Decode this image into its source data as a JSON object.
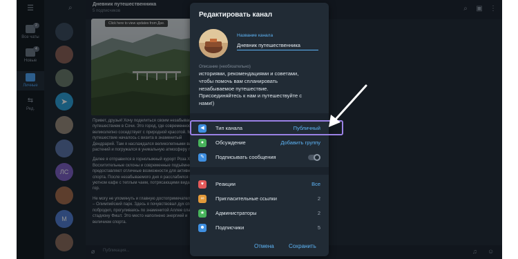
{
  "rail": {
    "items": [
      {
        "label": "Все чаты",
        "badge": "2"
      },
      {
        "label": "Новые",
        "badge": "4"
      },
      {
        "label": "Личные",
        "badge": ""
      },
      {
        "label": "Ред.",
        "badge": ""
      }
    ]
  },
  "chatlist": {
    "avatar_initials": "ЛС",
    "avatar_initials_2": "М"
  },
  "chat": {
    "title": "Дневник путешественника",
    "subtitle": "5 подписчиков",
    "banner": "Click here to view updates from Дне.",
    "post_paragraphs": [
      "Привет, друзья! Хочу поделиться своим незабываемым путешествием в Сочи. Это город, где современность великолепно соседствует с природной красотой. Моё путешествие началось с визита в знаменитый Дендрарий. Там я наслаждался великолепными видами растений и погружался в уникальную атмосферу парка.",
      "Далее я отправился в горнолыжный курорт Роза Хутор. Восхитительные склоны и современные подъёмники предоставляют отличные возможности для активного спорта. После незабываемого дня я расслабился в уютном кафе с теплым чаем, потрясающими видами гор.",
      "Не могу не упомянуть и главную достопримечательность – Олимпийский парк. Здесь я почувствовал дух спорта, побродил, прогуливаясь по знаменитой Аллее славы и стадиону Фишт. Это место наполнено энергией и величием спорта."
    ],
    "composer_placeholder": "Публикация..."
  },
  "dialog": {
    "title": "Редактировать канал",
    "name_label": "Название канала",
    "name_value": "Дневник путешественника",
    "desc_label": "Описание (необязательно)",
    "desc_lines": [
      "историями, рекомендациями и советами,",
      "чтобы помочь вам спланировать",
      "незабываемое путешествие.",
      "Присоединяйтесь к нам и путешествуйте с",
      "нами!)"
    ],
    "rows_group1": [
      {
        "label": "Тип канала",
        "value": "Публичный"
      },
      {
        "label": "Обсуждение",
        "value": "Добавить группу"
      },
      {
        "label": "Подписывать сообщения",
        "value": ""
      }
    ],
    "rows_group2": [
      {
        "label": "Реакции",
        "value": "Все"
      },
      {
        "label": "Пригласительные ссылки",
        "value": "2"
      },
      {
        "label": "Администраторы",
        "value": "2"
      },
      {
        "label": "Подписчики",
        "value": "5"
      }
    ],
    "sign_messages_enabled": false,
    "cancel_label": "Отмена",
    "save_label": "Сохранить"
  },
  "colors": {
    "accent": "#5eb5f7",
    "highlight": "#9b82e6",
    "arrow": "#ffffff"
  }
}
